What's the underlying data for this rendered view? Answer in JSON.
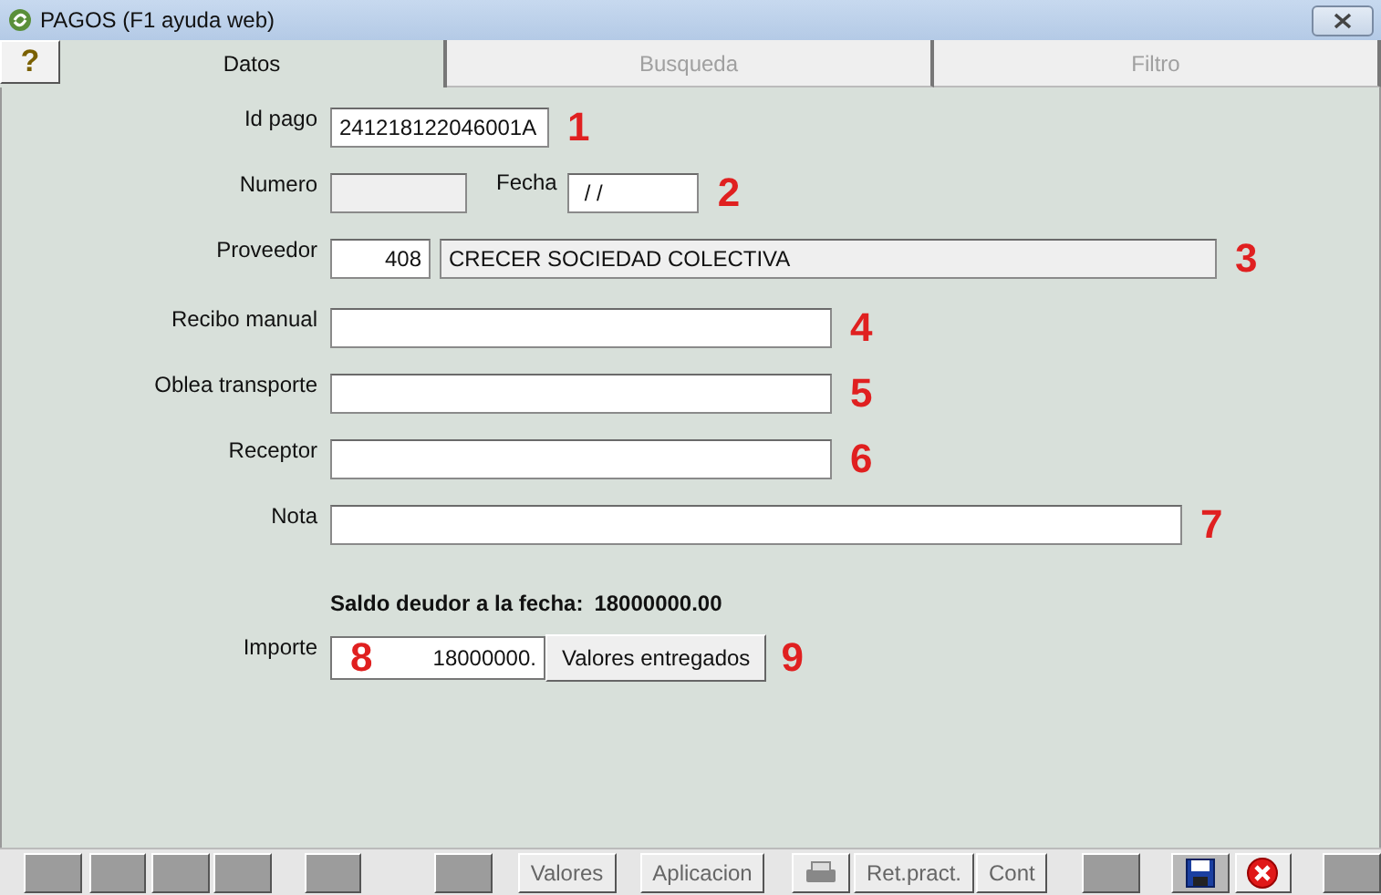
{
  "window": {
    "title": "PAGOS (F1 ayuda web)"
  },
  "help_button": {
    "label": "?"
  },
  "tabs": [
    {
      "label": "Datos",
      "selected": true,
      "disabled": false
    },
    {
      "label": "Busqueda",
      "selected": false,
      "disabled": true
    },
    {
      "label": "Filtro",
      "selected": false,
      "disabled": true
    }
  ],
  "form": [
    {
      "label": "Id pago",
      "marker": "1",
      "fields": [
        {
          "kind": "id",
          "value": "241218122046001A",
          "disabled": false
        }
      ]
    },
    {
      "label": "Numero",
      "marker": "2",
      "fields": [
        {
          "kind": "short",
          "disabled": true
        },
        {
          "kind": "date",
          "label": "Fecha",
          "value": "/ /",
          "disabled": false
        }
      ]
    },
    {
      "label": "Proveedor",
      "marker": "3",
      "fields": [
        {
          "kind": "code",
          "value": "408",
          "disabled": false
        },
        {
          "kind": "name",
          "value": "CRECER SOCIEDAD COLECTIVA",
          "disabled": true
        }
      ]
    },
    {
      "label": "Recibo manual",
      "marker": "4",
      "fields": [
        {
          "kind": "medium",
          "disabled": false
        }
      ]
    },
    {
      "label": "Oblea transporte",
      "marker": "5",
      "fields": [
        {
          "kind": "medium",
          "disabled": false
        }
      ]
    },
    {
      "label": "Receptor",
      "marker": "6",
      "fields": [
        {
          "kind": "medium",
          "disabled": false
        }
      ]
    },
    {
      "label": "Nota",
      "marker": "7",
      "fields": [
        {
          "kind": "wide",
          "disabled": false
        }
      ]
    }
  ],
  "saldo": {
    "label": "Saldo deudor a la fecha:",
    "value": "18000000.00"
  },
  "importe": {
    "label": "Importe",
    "marker": "8",
    "value": "18000000.",
    "button": "Valores entregados",
    "button_marker": "9"
  },
  "toolbar": [
    {
      "kind": "blank"
    },
    {
      "kind": "blank"
    },
    {
      "kind": "blank"
    },
    {
      "kind": "blank"
    },
    {
      "kind": "blank"
    },
    {
      "kind": "blank"
    },
    {
      "kind": "text",
      "label": "Valores"
    },
    {
      "kind": "text",
      "label": "Aplicacion"
    },
    {
      "kind": "printer"
    },
    {
      "kind": "text",
      "label": "Ret.pract."
    },
    {
      "kind": "text",
      "label": "Cont"
    },
    {
      "kind": "blank"
    },
    {
      "kind": "save"
    },
    {
      "kind": "close"
    },
    {
      "kind": "blank"
    }
  ]
}
